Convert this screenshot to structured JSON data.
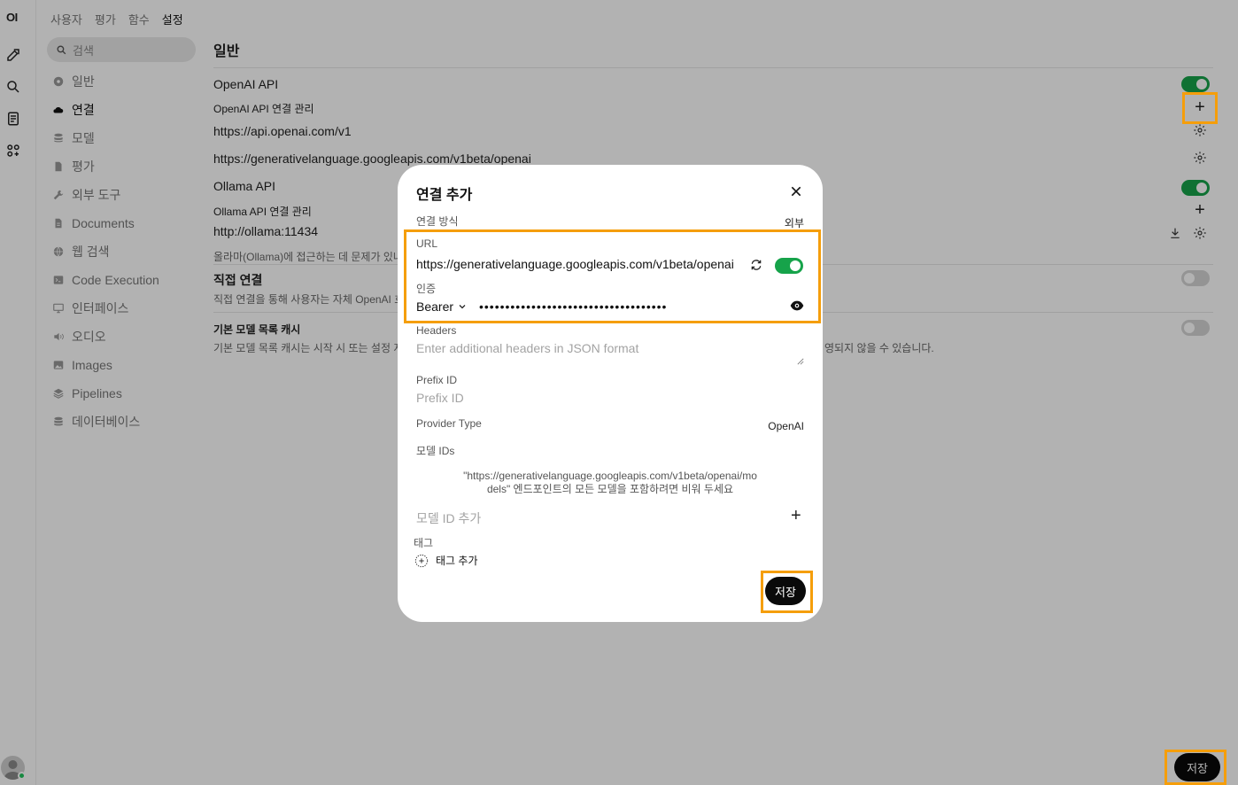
{
  "rail": {
    "logo": "OI"
  },
  "nav": {
    "tabs": [
      "사용자",
      "평가",
      "함수",
      "설정"
    ],
    "active_tab": "설정",
    "search_placeholder": "검색",
    "items": [
      {
        "label": "일반",
        "icon": "gear-icon"
      },
      {
        "label": "연결",
        "icon": "cloud-icon"
      },
      {
        "label": "모델",
        "icon": "stack-icon"
      },
      {
        "label": "평가",
        "icon": "document-icon"
      },
      {
        "label": "외부 도구",
        "icon": "wrench-icon"
      },
      {
        "label": "Documents",
        "icon": "file-icon"
      },
      {
        "label": "웹 검색",
        "icon": "globe-icon"
      },
      {
        "label": "Code Execution",
        "icon": "terminal-icon"
      },
      {
        "label": "인터페이스",
        "icon": "monitor-icon"
      },
      {
        "label": "오디오",
        "icon": "speaker-icon"
      },
      {
        "label": "Images",
        "icon": "image-icon"
      },
      {
        "label": "Pipelines",
        "icon": "layers-icon"
      },
      {
        "label": "데이터베이스",
        "icon": "database-icon"
      }
    ],
    "active_item": "연결"
  },
  "content": {
    "section_title": "일반",
    "openai_api": "OpenAI API",
    "openai_manage": "OpenAI API 연결 관리",
    "openai_url_1": "https://api.openai.com/v1",
    "openai_url_2": "https://generativelanguage.googleapis.com/v1beta/openai",
    "ollama_api": "Ollama API",
    "ollama_manage": "Ollama API 연결 관리",
    "ollama_url": "http://ollama:11434",
    "ollama_note": "올라마(Ollama)에 접근하는 데 문제가 있나",
    "direct_title": "직접 연결",
    "direct_desc": "직접 연결을 통해 사용자는 자체 OpenAI 호",
    "cache_title": "기본 모델 목록 캐시",
    "cache_desc": "기본 모델 목록 캐시는 시작 시 또는 설정 저장",
    "cache_desc_tail": "영되지 않을 수 있습니다.",
    "save": "저장"
  },
  "modal": {
    "title": "연결 추가",
    "connection_type_label": "연결 방식",
    "connection_type_value": "외부",
    "url_label": "URL",
    "url_value": "https://generativelanguage.googleapis.com/v1beta/openai",
    "auth_label": "인증",
    "auth_type": "Bearer",
    "auth_key_masked": "••••••••••••••••••••••••••••••••••••",
    "headers_label": "Headers",
    "headers_placeholder": "Enter additional headers in JSON format",
    "prefix_label": "Prefix ID",
    "prefix_placeholder": "Prefix ID",
    "provider_label": "Provider Type",
    "provider_value": "OpenAI",
    "model_ids_label": "모델 IDs",
    "model_ids_hint_1": "\"https://generativelanguage.googleapis.com/v1beta/openai/mo",
    "model_ids_hint_2": "dels\" 엔드포인트의 모든 모델을 포함하려면 비워 두세요",
    "add_model_placeholder": "모델 ID 추가",
    "tags_label": "태그",
    "add_tag": "태그 추가",
    "save": "저장"
  },
  "colors": {
    "highlight": "#f59e0b",
    "toggle_on": "#16a34a",
    "primary_button": "#0a0a0a"
  }
}
